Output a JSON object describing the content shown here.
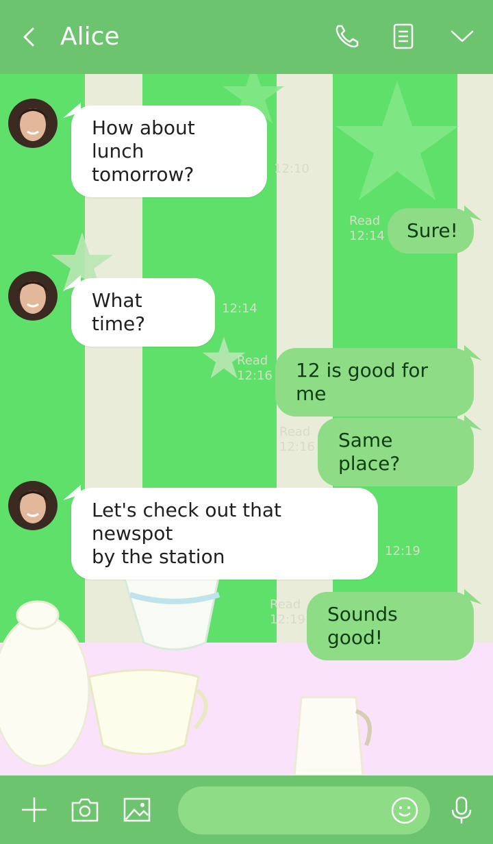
{
  "header": {
    "title": "Alice",
    "icons": [
      "back-chevron-icon",
      "phone-icon",
      "notes-icon",
      "chevron-down-icon"
    ]
  },
  "messages": [
    {
      "direction": "in",
      "lines": [
        "How about lunch",
        "tomorrow?"
      ],
      "time": "12:10"
    },
    {
      "direction": "out",
      "text": "Sure!",
      "read": "Read",
      "time": "12:14"
    },
    {
      "direction": "in",
      "lines": [
        "What time?"
      ],
      "time": "12:14"
    },
    {
      "direction": "out",
      "text": "12 is good for me",
      "read": "Read",
      "time": "12:16"
    },
    {
      "direction": "out",
      "text": "Same place?",
      "read": "Read",
      "time": "12:16"
    },
    {
      "direction": "in",
      "lines": [
        "Let's check out that newspot",
        "by the station"
      ],
      "time": "12:19"
    },
    {
      "direction": "out",
      "text": "Sounds good!",
      "read": "Read",
      "time": "12:19"
    }
  ],
  "footer": {
    "input_value": "",
    "icons": [
      "plus-icon",
      "camera-icon",
      "image-icon",
      "emoji-icon",
      "microphone-icon"
    ]
  },
  "colors": {
    "header_bg": "#6dc46f",
    "chat_bg": "#5fe06b",
    "outgoing_bubble": "#8fdc86",
    "incoming_bubble": "#ffffff",
    "floor": "#fbe2fb"
  }
}
